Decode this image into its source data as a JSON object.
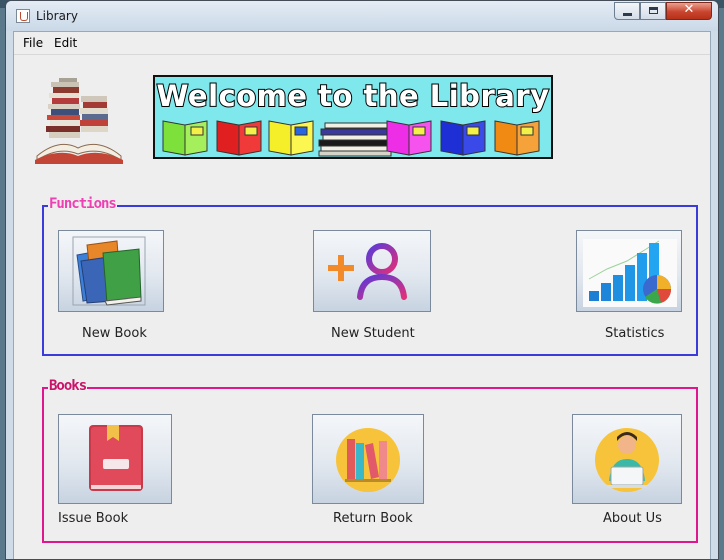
{
  "window": {
    "title": "Library"
  },
  "menubar": {
    "items": [
      "File",
      "Edit"
    ]
  },
  "banner": {
    "text": "Welcome to the Library"
  },
  "groups": {
    "functions": {
      "title": "Functions",
      "buttons": [
        {
          "label": "New Book",
          "icon": "books-icon"
        },
        {
          "label": "New Student",
          "icon": "add-user-icon"
        },
        {
          "label": "Statistics",
          "icon": "chart-icon"
        }
      ]
    },
    "books": {
      "title": "Books",
      "buttons": [
        {
          "label": "Issue Book",
          "icon": "book-bookmark-icon"
        },
        {
          "label": "Return Book",
          "icon": "bookshelf-icon"
        },
        {
          "label": "About Us",
          "icon": "user-laptop-icon"
        }
      ]
    }
  },
  "colors": {
    "functions_border": "#3b3bdc",
    "functions_title": "#ee3fb3",
    "books_border": "#e0168e",
    "books_title": "#cc1168"
  }
}
